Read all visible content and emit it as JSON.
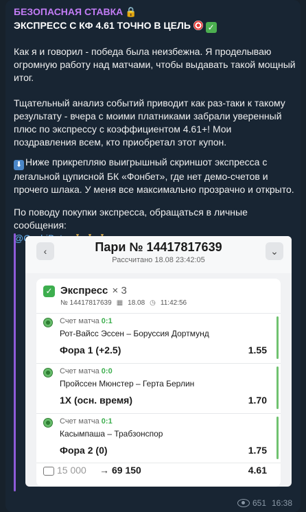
{
  "post": {
    "channel_name": "БЕЗОПАСНАЯ СТАВКА",
    "headline": "ЭКСПРЕСС С КФ 4.61 ТОЧНО В ЦЕЛЬ",
    "p1": "Как я и говорил - победа была неизбежна. Я проделываю огромную работу над матчами, чтобы выдавать такой мощный итог.",
    "p2": "Тщательный анализ событий приводит как раз-таки к такому результату - вчера с моими платниками забрали уверенный плюс по экспрессу с коэффициентом 4.61+! Мои поздравления всем, кто приобретал этот купон.",
    "p3": "Ниже прикрепляю выигрышный скриншот экспресса с легальной цуписной БК «Фонбет», где нет демо-счетов и прочего шлака. У меня все максимально прозрачно и открыто.",
    "p4": "По поводу покупки экспресса, обращаться в личные сообщения:",
    "contact": "@OvchiBets",
    "views": "651",
    "time": "16:38"
  },
  "bet": {
    "title": "Пари № 14417817639",
    "calculated": "Рассчитано 18.08 23:42:05",
    "type": "Экспресс",
    "multiplier": "× 3",
    "number": "№ 14417817639",
    "date": "18.08",
    "time": "11:42:56",
    "events": [
      {
        "score_label": "Счет матча",
        "score": "0:1",
        "teams": "Рот-Вайсс Эссен – Боруссия Дортмунд",
        "pick": "Фора 1 (+2.5)",
        "odd": "1.55"
      },
      {
        "score_label": "Счет матча",
        "score": "0:0",
        "teams": "Пройссен Мюнстер – Герта Берлин",
        "pick": "1X (осн. время)",
        "odd": "1.70"
      },
      {
        "score_label": "Счет матча",
        "score": "0:1",
        "teams": "Касымпаша – Трабзонспор",
        "pick": "Фора 2 (0)",
        "odd": "1.75"
      }
    ],
    "stake": "15 000",
    "arrow": "→",
    "payout": "69 150",
    "total_odd": "4.61"
  },
  "colors": {
    "accent_purple": "#c27cf5",
    "link": "#6ab3f3",
    "win_green": "#3dae4e"
  }
}
